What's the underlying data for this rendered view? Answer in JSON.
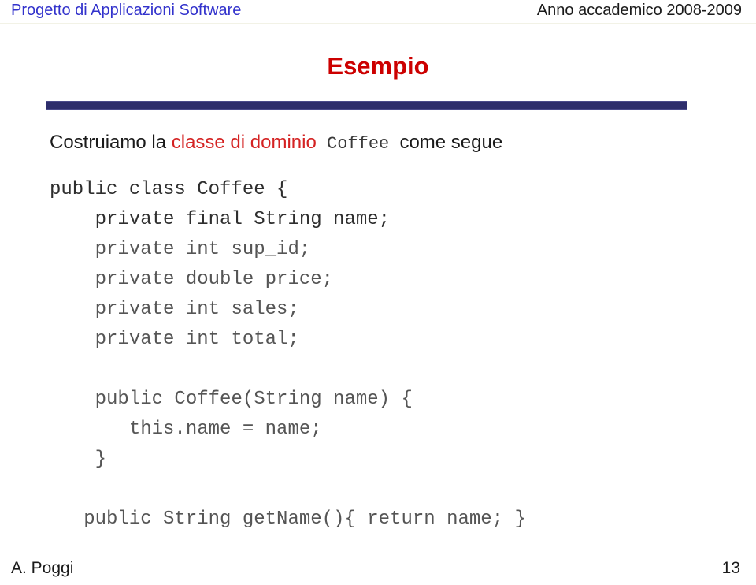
{
  "header": {
    "course_title": "Progetto di Applicazioni Software",
    "academic_year": "Anno accademico 2008-2009"
  },
  "slide": {
    "title": "Esempio",
    "intro": {
      "part1": "Costruiamo la ",
      "highlight": "classe di dominio",
      "part2_mono": " Coffee ",
      "part3": "come segue"
    },
    "code_lines": [
      {
        "text": "public class Coffee {",
        "dim": false
      },
      {
        "text": "    private final String name;",
        "dim": false
      },
      {
        "text": "    private int sup_id;",
        "dim": true
      },
      {
        "text": "    private double price;",
        "dim": true
      },
      {
        "text": "    private int sales;",
        "dim": true
      },
      {
        "text": "    private int total;",
        "dim": true
      },
      {
        "text": "",
        "dim": false
      },
      {
        "text": "    public Coffee(String name) {",
        "dim": true
      },
      {
        "text": "       this.name = name;",
        "dim": true
      },
      {
        "text": "    }",
        "dim": true
      },
      {
        "text": "",
        "dim": false
      },
      {
        "text": "   public String getName(){ return name; }",
        "dim": true
      }
    ]
  },
  "footer": {
    "author": "A. Poggi",
    "page_number": "13"
  },
  "colors": {
    "header_link": "#3333cc",
    "title_red": "#cc0000",
    "accent_bar": "#2d2d6b",
    "highlight_red": "#d42222",
    "body_text": "#1a1a1a"
  }
}
